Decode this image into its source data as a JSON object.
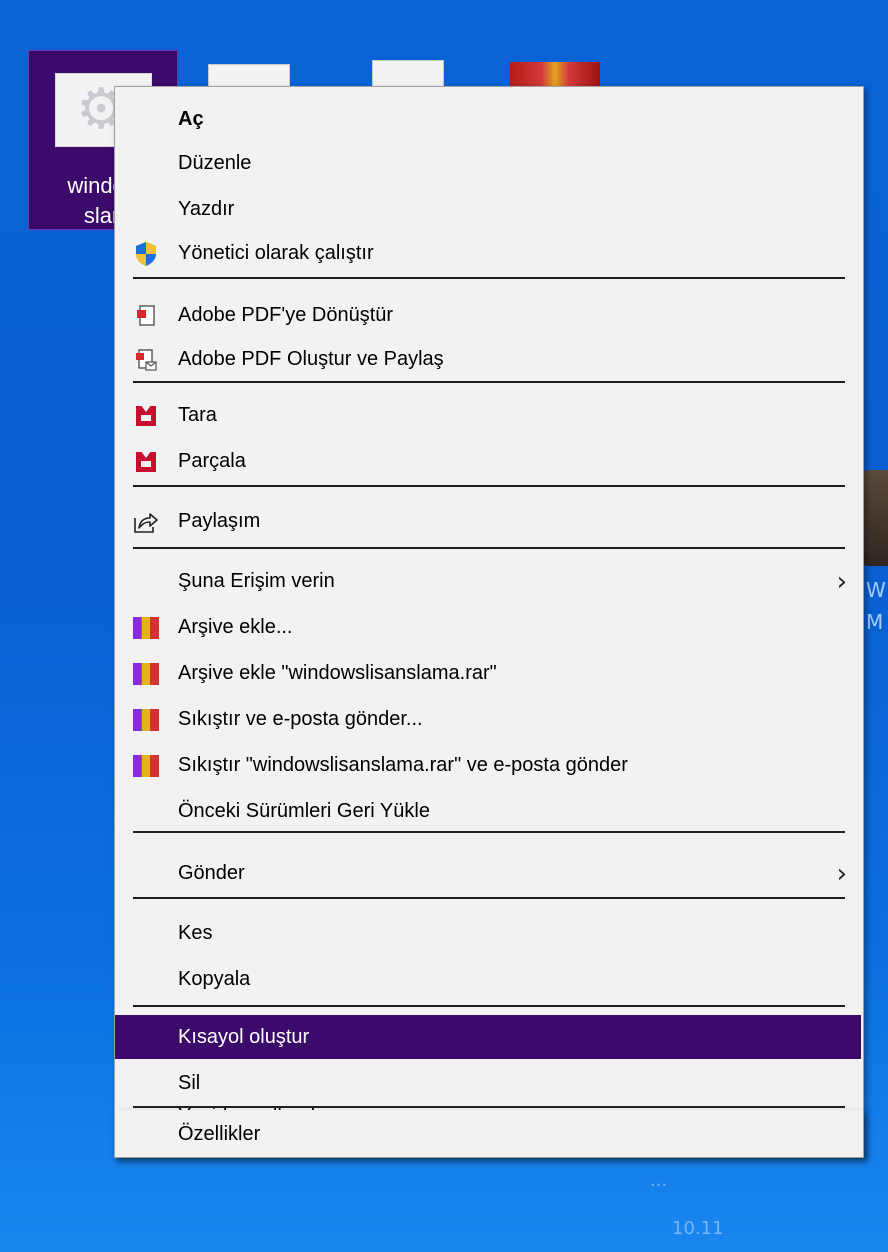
{
  "desktop": {
    "selected_icon": {
      "label": "window\nslan",
      "icon": "settings-file-icon"
    },
    "right_edge_text_1": "W",
    "right_edge_text_2": "M",
    "bottom_label_1": "...",
    "bottom_label_2": "10.11"
  },
  "context_menu": {
    "highlight_color": "#3b0a6b",
    "items": [
      {
        "label": "Aç",
        "icon": null,
        "default": true
      },
      {
        "label": "Düzenle",
        "icon": null
      },
      {
        "label": "Yazdır",
        "icon": null
      },
      {
        "label": "Yönetici olarak çalıştır",
        "icon": "uac-shield-icon"
      },
      {
        "label": "Adobe PDF'ye Dönüştür",
        "icon": "adobe-pdf-icon"
      },
      {
        "label": "Adobe PDF Oluştur ve Paylaş",
        "icon": "adobe-pdf-share-icon"
      },
      {
        "label": "Tara",
        "icon": "mcafee-icon"
      },
      {
        "label": "Parçala",
        "icon": "mcafee-icon"
      },
      {
        "label": "Paylaşım",
        "icon": "share-icon"
      },
      {
        "label": "Şuna Erişim verin",
        "icon": null,
        "submenu": true
      },
      {
        "label": "Arşive ekle...",
        "icon": "winrar-icon"
      },
      {
        "label": "Arşive ekle \"windowslisanslama.rar\"",
        "icon": "winrar-icon"
      },
      {
        "label": "Sıkıştır ve e-posta gönder...",
        "icon": "winrar-icon"
      },
      {
        "label": "Sıkıştır \"windowslisanslama.rar\" ve e-posta gönder",
        "icon": "winrar-icon"
      },
      {
        "label": "Önceki Sürümleri Geri Yükle",
        "icon": null
      },
      {
        "label": "Gönder",
        "icon": null,
        "submenu": true
      },
      {
        "label": "Kes",
        "icon": null
      },
      {
        "label": "Kopyala",
        "icon": null
      },
      {
        "label": "Kısayol oluştur",
        "icon": null,
        "highlighted": true
      },
      {
        "label": "Sil",
        "icon": null
      },
      {
        "label": "Yeniden adlandır",
        "icon": null
      },
      {
        "label": "Özellikler",
        "icon": null
      }
    ],
    "submenu_glyph": "›"
  }
}
